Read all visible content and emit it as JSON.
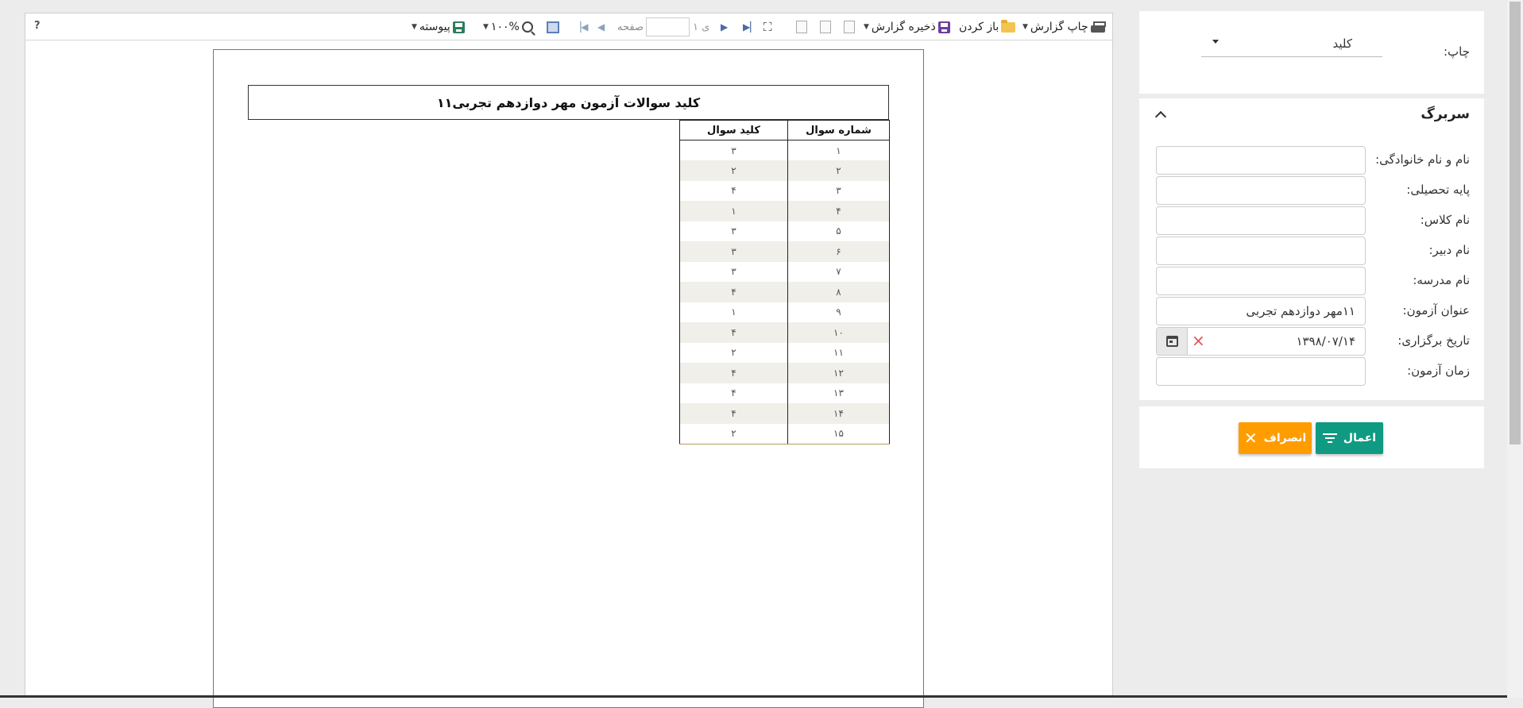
{
  "toolbar": {
    "help": "?",
    "print_label": "چاپ گزارش",
    "open_label": "باز کردن",
    "save_label": "ذخیره گزارش",
    "page_label": "صفحه",
    "of_label": "ی ۱",
    "zoom_label": "۱۰۰%",
    "view_mode_label": "پیوسته",
    "colors": {
      "save_icon": "#6c3f9c",
      "view_icon": "#2e7d5b"
    }
  },
  "report": {
    "title": "کلید سوالات آزمون مهر دوازدهم تجربی۱۱",
    "columns": [
      "شماره سوال",
      "کلید سوال"
    ],
    "rows": [
      [
        "۱",
        "۳"
      ],
      [
        "۲",
        "۲"
      ],
      [
        "۳",
        "۴"
      ],
      [
        "۴",
        "۱"
      ],
      [
        "۵",
        "۳"
      ],
      [
        "۶",
        "۳"
      ],
      [
        "۷",
        "۳"
      ],
      [
        "۸",
        "۴"
      ],
      [
        "۹",
        "۱"
      ],
      [
        "۱۰",
        "۴"
      ],
      [
        "۱۱",
        "۲"
      ],
      [
        "۱۲",
        "۴"
      ],
      [
        "۱۳",
        "۴"
      ],
      [
        "۱۴",
        "۴"
      ],
      [
        "۱۵",
        "۲"
      ]
    ]
  },
  "print_panel": {
    "label": "چاپ:",
    "selected": "کلید"
  },
  "header_panel": {
    "title": "سربرگ",
    "fields": {
      "full_name": {
        "label": "نام و نام خانوادگی:",
        "value": ""
      },
      "grade": {
        "label": "پایه تحصیلی:",
        "value": ""
      },
      "class_name": {
        "label": "نام کلاس:",
        "value": ""
      },
      "teacher": {
        "label": "نام دبیر:",
        "value": ""
      },
      "school": {
        "label": "نام مدرسه:",
        "value": ""
      },
      "exam_title": {
        "label": "عنوان آزمون:",
        "value": "۱۱مهر دوازدهم تجربی"
      },
      "exam_date": {
        "label": "تاریخ برگزاری:",
        "value": "۱۳۹۸/۰۷/۱۴"
      },
      "exam_time": {
        "label": "زمان آزمون:",
        "value": ""
      }
    }
  },
  "actions": {
    "apply_label": "اعمال",
    "cancel_label": "انصراف",
    "colors": {
      "apply": "#109a82",
      "cancel": "#ff9d00"
    }
  }
}
